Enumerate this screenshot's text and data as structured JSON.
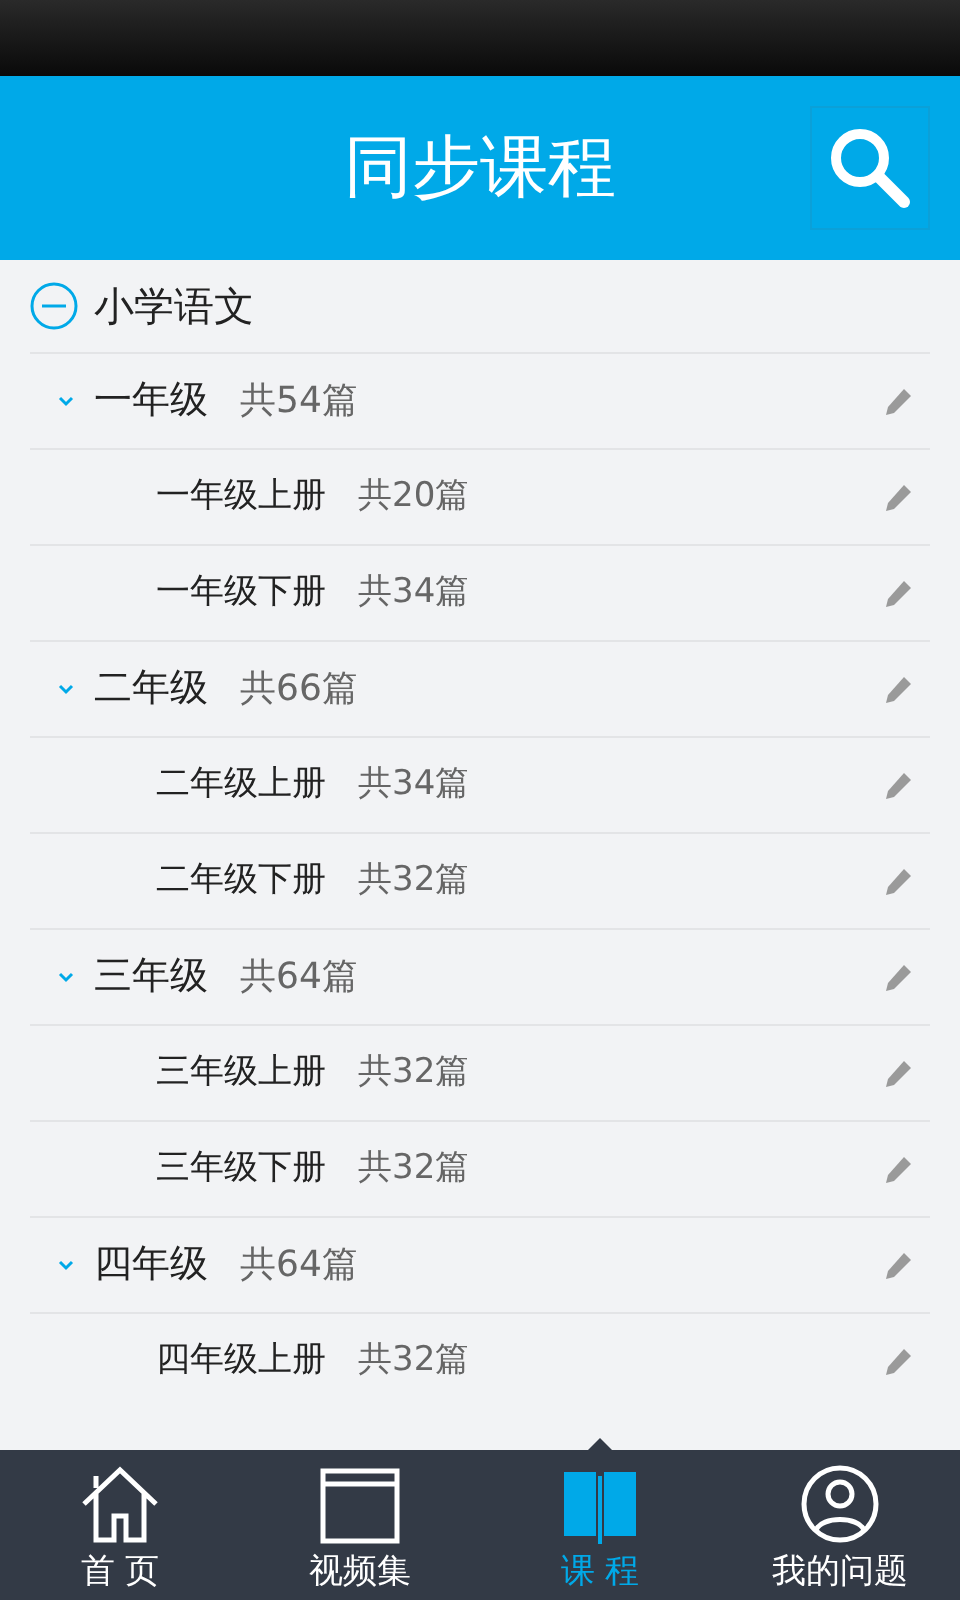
{
  "header": {
    "title": "同步课程"
  },
  "tree": [
    {
      "name": "小学语文",
      "expanded": true,
      "children": [
        {
          "name": "一年级",
          "count": "共54篇",
          "expanded": true,
          "children": [
            {
              "name": "一年级上册",
              "count": "共20篇"
            },
            {
              "name": "一年级下册",
              "count": "共34篇"
            }
          ]
        },
        {
          "name": "二年级",
          "count": "共66篇",
          "expanded": true,
          "children": [
            {
              "name": "二年级上册",
              "count": "共34篇"
            },
            {
              "name": "二年级下册",
              "count": "共32篇"
            }
          ]
        },
        {
          "name": "三年级",
          "count": "共64篇",
          "expanded": true,
          "children": [
            {
              "name": "三年级上册",
              "count": "共32篇"
            },
            {
              "name": "三年级下册",
              "count": "共32篇"
            }
          ]
        },
        {
          "name": "四年级",
          "count": "共64篇",
          "expanded": true,
          "children": [
            {
              "name": "四年级上册",
              "count": "共32篇"
            }
          ]
        }
      ]
    }
  ],
  "tabs": [
    {
      "label": "首 页",
      "kind": "home",
      "selected": false
    },
    {
      "label": "视频集",
      "kind": "video",
      "selected": false
    },
    {
      "label": "课 程",
      "kind": "course",
      "selected": true
    },
    {
      "label": "我的问题",
      "kind": "profile",
      "selected": false
    }
  ]
}
